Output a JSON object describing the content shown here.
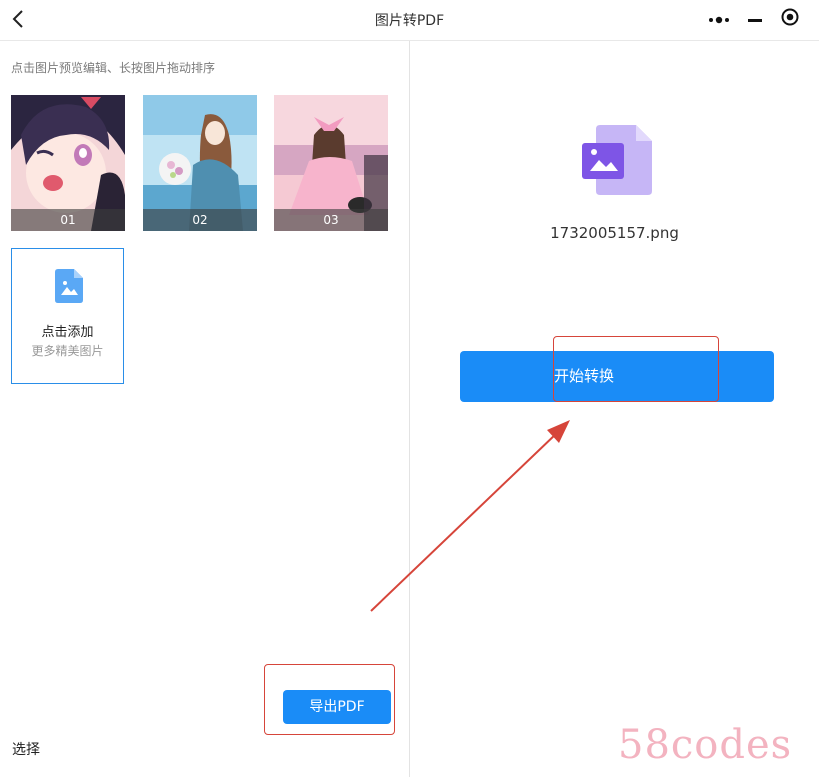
{
  "titlebar": {
    "title": "图片转PDF",
    "back_icon": "chevron-left-icon"
  },
  "capsule": {
    "more_icon": "more-dots-icon",
    "minimize_icon": "minimize-icon",
    "close_icon": "target-close-icon"
  },
  "left": {
    "hint": "点击图片预览编辑、长按图片拖动排序",
    "images": [
      {
        "label": "01",
        "subject": "anime girl with bow"
      },
      {
        "label": "02",
        "subject": "girl with flowers by sea"
      },
      {
        "label": "03",
        "subject": "girl in pink dress with cat"
      }
    ],
    "add_card": {
      "line1": "点击添加",
      "line2": "更多精美图片",
      "icon": "image-file-icon"
    },
    "select_label": "选择",
    "export_label": "导出PDF"
  },
  "right": {
    "file_icon": "image-file-icon",
    "file_name": "1732005157.png",
    "convert_label": "开始转换"
  },
  "colors": {
    "accent": "#1a8cf7",
    "annotation": "#d6453a",
    "file_icon": "#a58cf0",
    "watermark": "#f3b3c0"
  },
  "watermark": "58codes"
}
